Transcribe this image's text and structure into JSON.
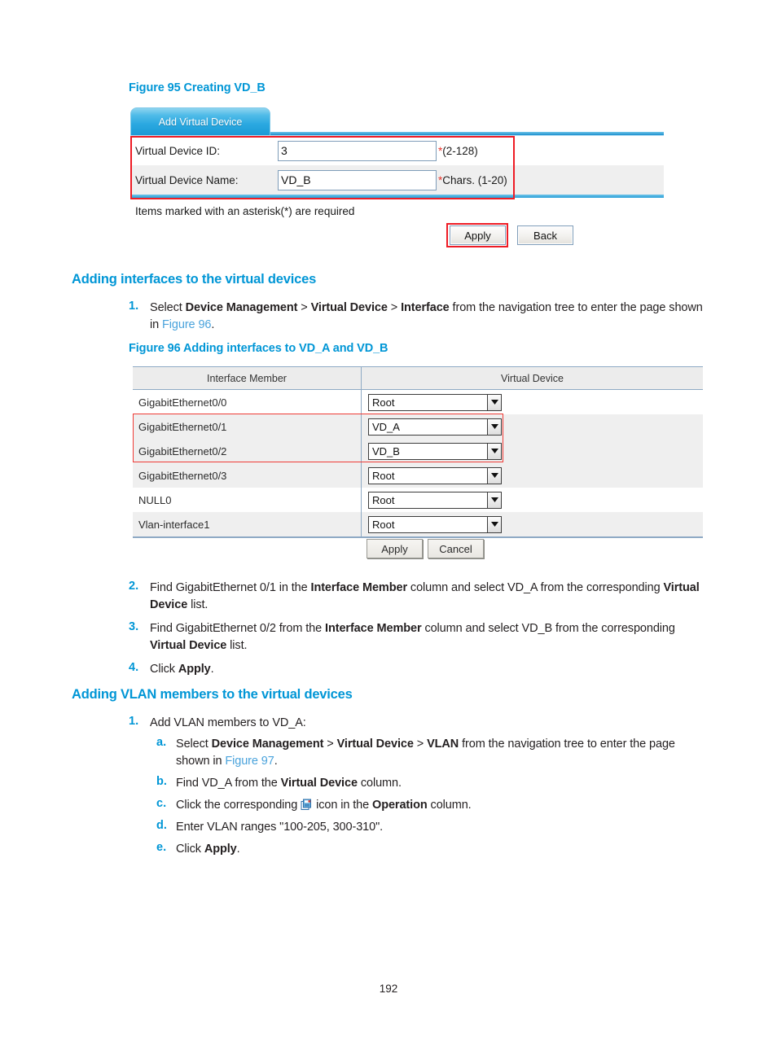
{
  "page": {
    "number": "192"
  },
  "figure95": {
    "caption": "Figure 95 Creating VD_B",
    "tab_label": "Add Virtual Device",
    "fields": [
      {
        "label": "Virtual Device ID:",
        "value": "3",
        "hint_ast": "*",
        "hint_text": "(2-128)"
      },
      {
        "label": "Virtual Device Name:",
        "value": "VD_B",
        "hint_ast": "*",
        "hint_text": "Chars. (1-20)"
      }
    ],
    "note": "Items marked with an asterisk(*) are required",
    "buttons": {
      "apply": "Apply",
      "back": "Back"
    }
  },
  "section1": {
    "heading": "Adding interfaces to the virtual devices",
    "step1": {
      "marker": "1.",
      "p1_a": "Select ",
      "p1_b1": "Device Management",
      "p1_c": " > ",
      "p1_b2": "Virtual Device",
      "p1_d": " > ",
      "p1_b3": "Interface",
      "p1_e": " from the navigation tree to enter the page shown in ",
      "p1_link": "Figure 96",
      "p1_f": "."
    },
    "step2": {
      "marker": "2.",
      "a": "Find GigabitEthernet 0/1 in the ",
      "b1": "Interface Member",
      "c": " column and select VD_A from the corresponding ",
      "b2": "Virtual Device",
      "d": " list."
    },
    "step3": {
      "marker": "3.",
      "a": "Find GigabitEthernet 0/2 from the ",
      "b1": "Interface Member",
      "c": " column and select VD_B from the corresponding ",
      "b2": "Virtual Device",
      "d": " list."
    },
    "step4": {
      "marker": "4.",
      "a": "Click ",
      "b1": "Apply",
      "d": "."
    }
  },
  "figure96": {
    "caption": "Figure 96 Adding interfaces to VD_A and VD_B",
    "columns": [
      "Interface Member",
      "Virtual Device"
    ],
    "rows": [
      {
        "member": "GigabitEthernet0/0",
        "device": "Root"
      },
      {
        "member": "GigabitEthernet0/1",
        "device": "VD_A"
      },
      {
        "member": "GigabitEthernet0/2",
        "device": "VD_B"
      },
      {
        "member": "GigabitEthernet0/3",
        "device": "Root"
      },
      {
        "member": "NULL0",
        "device": "Root"
      },
      {
        "member": "Vlan-interface1",
        "device": "Root"
      }
    ],
    "buttons": {
      "apply": "Apply",
      "cancel": "Cancel"
    }
  },
  "section2": {
    "heading": "Adding VLAN members to the virtual devices",
    "step1": {
      "marker": "1.",
      "text": "Add VLAN members to VD_A:"
    },
    "sub_a": {
      "marker": "a.",
      "a": "Select ",
      "b1": "Device Management",
      "c": " > ",
      "b2": "Virtual Device",
      "d": " > ",
      "b3": "VLAN",
      "e": " from the navigation tree to enter the page shown in ",
      "link": "Figure 97",
      "f": "."
    },
    "sub_b": {
      "marker": "b.",
      "a": "Find VD_A from the ",
      "b1": "Virtual Device",
      "c": " column."
    },
    "sub_c": {
      "marker": "c.",
      "a": "Click the corresponding ",
      "icon": "vlan-operation-icon",
      "b": " icon in the ",
      "b1": "Operation",
      "c": " column."
    },
    "sub_d": {
      "marker": "d.",
      "a": "Enter VLAN ranges \"100-205, 300-310\"."
    },
    "sub_e": {
      "marker": "e.",
      "a": "Click ",
      "b1": "Apply",
      "c": "."
    }
  },
  "colors": {
    "accent_blue": "#0096d6",
    "link_blue": "#4aa3dc",
    "annotation_red": "#ee1c25",
    "text": "#231f20"
  }
}
